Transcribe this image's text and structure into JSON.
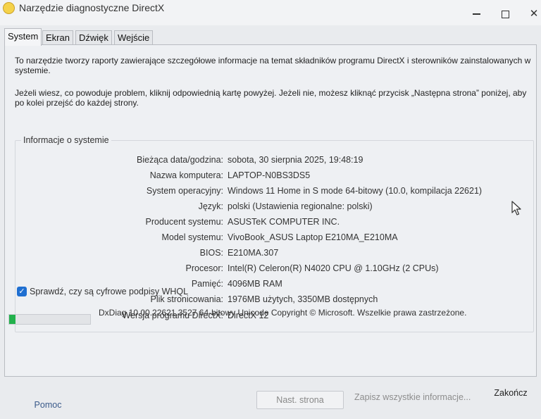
{
  "window": {
    "title": "Narzędzie diagnostyczne DirectX",
    "controls": {
      "minimize": "minimize",
      "maximize": "maximize",
      "close": "✕"
    }
  },
  "tabs": [
    {
      "label": "System",
      "active": true
    },
    {
      "label": "Ekran",
      "active": false
    },
    {
      "label": "Dźwięk",
      "active": false
    },
    {
      "label": "Wejście",
      "active": false
    }
  ],
  "intro": {
    "line1": "To narzędzie tworzy raporty zawierające szczegółowe informacje na temat składników programu DirectX i sterowników zainstalowanych w systemie.",
    "line2": "Jeżeli wiesz, co powoduje problem, kliknij odpowiednią kartę powyżej. Jeżeli nie, możesz kliknąć przycisk „Następna strona” poniżej, aby po kolei przejść do każdej strony."
  },
  "system_info": {
    "title": "Informacje o systemie",
    "rows": [
      {
        "label": "Bieżąca data/godzina:",
        "value": "sobota, 30 sierpnia 2025, 19:48:19"
      },
      {
        "label": "Nazwa komputera:",
        "value": "LAPTOP-N0BS3DS5"
      },
      {
        "label": "System operacyjny:",
        "value": "Windows 11 Home in S mode 64-bitowy (10.0, kompilacja 22621)"
      },
      {
        "label": "Język:",
        "value": "polski (Ustawienia regionalne: polski)"
      },
      {
        "label": "Producent systemu:",
        "value": "ASUSTeK COMPUTER INC."
      },
      {
        "label": "Model systemu:",
        "value": "VivoBook_ASUS Laptop E210MA_E210MA"
      },
      {
        "label": "BIOS:",
        "value": "E210MA.307"
      },
      {
        "label": "Procesor:",
        "value": "Intel(R) Celeron(R) N4020 CPU @ 1.10GHz (2 CPUs)"
      },
      {
        "label": "Pamięć:",
        "value": "4096MB RAM"
      },
      {
        "label": "Plik stronicowania:",
        "value": "1976MB użytych, 3350MB dostępnych"
      },
      {
        "label": "Wersja programu DirectX:",
        "value": "DirectX 12"
      }
    ]
  },
  "checkbox": {
    "label": "Sprawdź, czy są cyfrowe podpisy WHQL",
    "checked": true,
    "mark": "✓"
  },
  "status": {
    "progress": 0.08,
    "text": "DxDiag 10.00.22621.3527 64-bitowy Unicode  Copyright © Microsoft. Wszelkie prawa zastrzeżone."
  },
  "buttons": {
    "help": "Pomoc",
    "next": "Nast. strona",
    "save": "Zapisz wszystkie informacje...",
    "exit": "Zakończ"
  },
  "colors": {
    "accent": "#1f6fd1",
    "progress": "#22b14c",
    "window_bg": "#eef0f3"
  }
}
